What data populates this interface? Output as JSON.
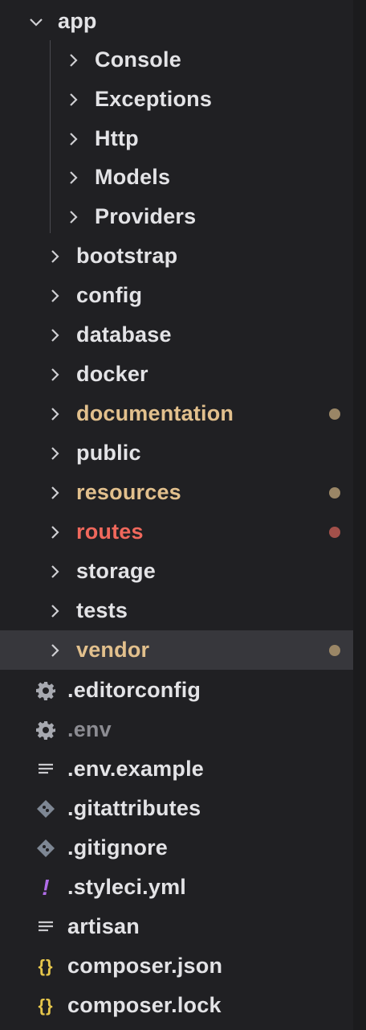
{
  "explorer": {
    "app_folder": {
      "label": "app",
      "expanded": true
    },
    "app_children": [
      {
        "label": "Console"
      },
      {
        "label": "Exceptions"
      },
      {
        "label": "Http"
      },
      {
        "label": "Models"
      },
      {
        "label": "Providers"
      }
    ],
    "folders": [
      {
        "label": "bootstrap"
      },
      {
        "label": "config"
      },
      {
        "label": "database"
      },
      {
        "label": "docker"
      },
      {
        "label": "documentation",
        "color": "#e2c08d",
        "badge_color": "#9a8666"
      },
      {
        "label": "public"
      },
      {
        "label": "resources",
        "color": "#e2c08d",
        "badge_color": "#9a8666"
      },
      {
        "label": "routes",
        "color": "#f0685c",
        "badge_color": "#a3504a"
      },
      {
        "label": "storage"
      },
      {
        "label": "tests"
      },
      {
        "label": "vendor",
        "color": "#e2c08d",
        "badge_color": "#9a8666",
        "selected": true
      }
    ],
    "files": [
      {
        "label": ".editorconfig",
        "icon": "gear-icon"
      },
      {
        "label": ".env",
        "icon": "gear-icon",
        "dimmed": true
      },
      {
        "label": ".env.example",
        "icon": "lines-icon"
      },
      {
        "label": ".gitattributes",
        "icon": "git-icon"
      },
      {
        "label": ".gitignore",
        "icon": "git-icon"
      },
      {
        "label": ".styleci.yml",
        "icon": "yaml-icon"
      },
      {
        "label": "artisan",
        "icon": "lines-icon"
      },
      {
        "label": "composer.json",
        "icon": "json-icon"
      },
      {
        "label": "composer.lock",
        "icon": "json-icon"
      }
    ],
    "colors": {
      "background": "#202023",
      "selected_row": "#37373c",
      "modified": "#e2c08d",
      "deleted": "#f0685c",
      "text": "#e3e3e6",
      "dim_text": "#8c8c92"
    }
  }
}
